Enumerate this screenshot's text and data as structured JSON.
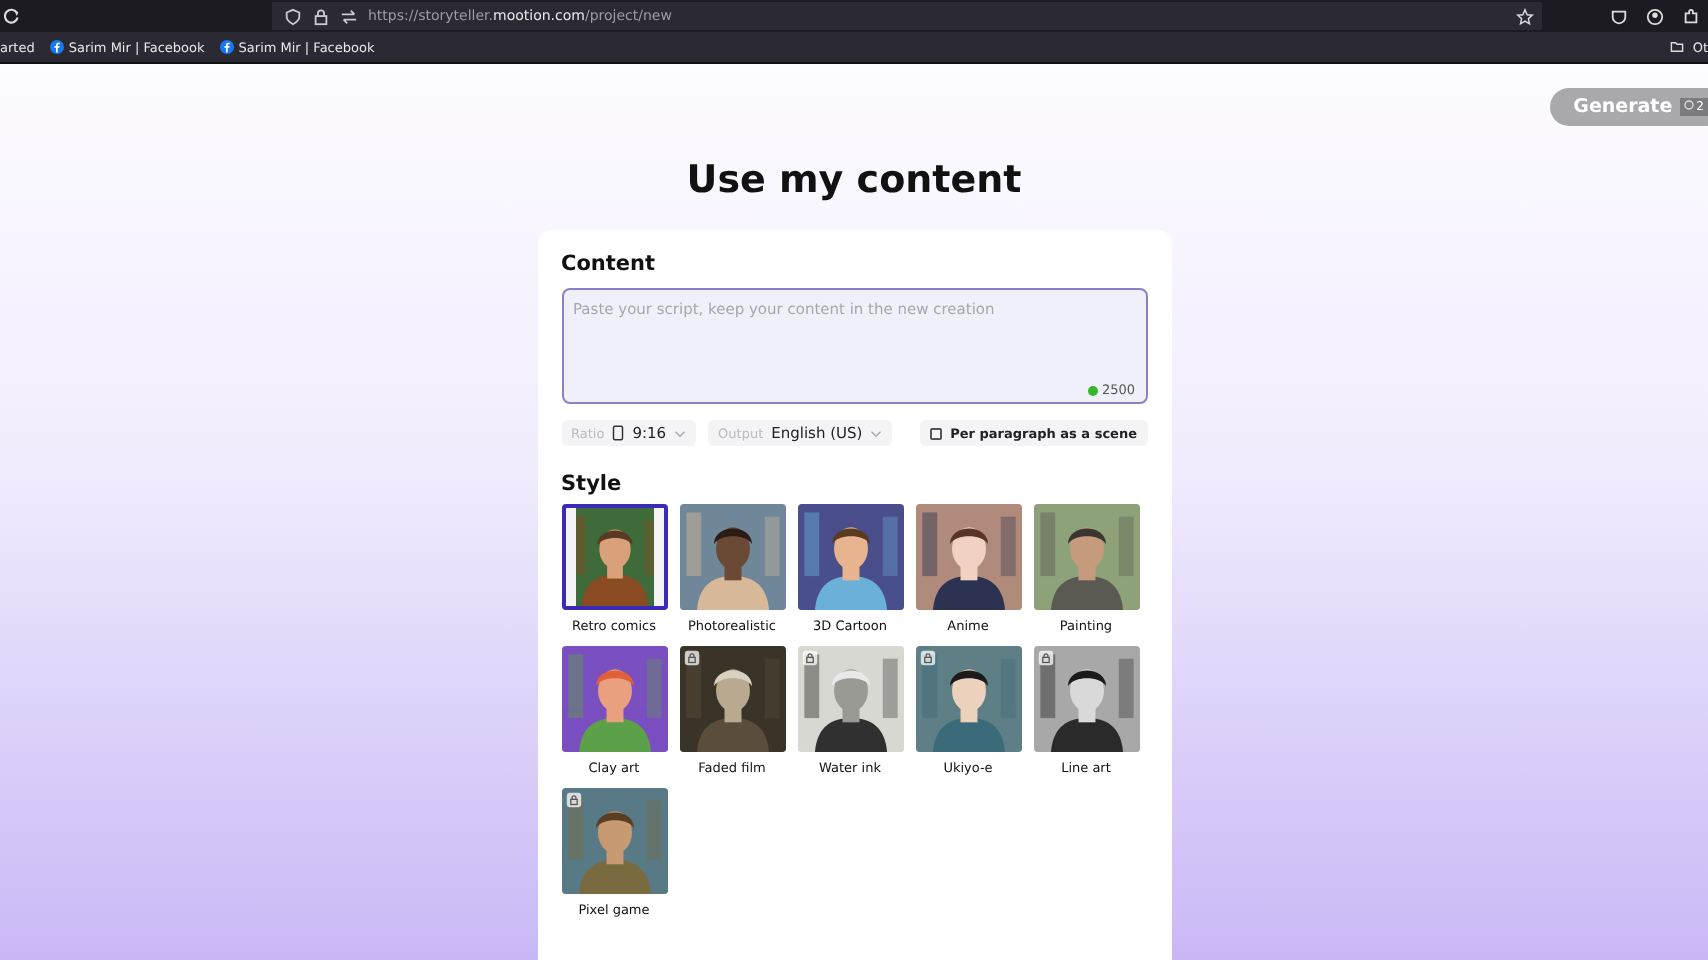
{
  "browser": {
    "url_prefix": "https://storyteller.",
    "url_domain": "mootion.com",
    "url_path": "/project/new",
    "bookmarks": [
      {
        "label": "arted",
        "kind": "plain"
      },
      {
        "label": "Sarim Mir | Facebook",
        "kind": "facebook"
      },
      {
        "label": "Sarim Mir | Facebook",
        "kind": "facebook"
      }
    ],
    "other_bookmarks": "Ot"
  },
  "generate": {
    "label": "Generate",
    "credits": "2"
  },
  "title": "Use my content",
  "content": {
    "heading": "Content",
    "placeholder": "Paste your script, keep your content in the new creation",
    "count": "2500"
  },
  "options": {
    "ratio_label": "Ratio",
    "ratio": "9:16",
    "output_label": "Output",
    "output": "English (US)",
    "per_paragraph": {
      "label": "Per paragraph as a scene",
      "checked": false
    }
  },
  "style": {
    "heading": "Style",
    "items": [
      {
        "label": "Retro comics",
        "selected": true,
        "locked": false
      },
      {
        "label": "Photorealistic",
        "selected": false,
        "locked": false
      },
      {
        "label": "3D Cartoon",
        "selected": false,
        "locked": false
      },
      {
        "label": "Anime",
        "selected": false,
        "locked": false
      },
      {
        "label": "Painting",
        "selected": false,
        "locked": false
      },
      {
        "label": "Clay art",
        "selected": false,
        "locked": false
      },
      {
        "label": "Faded film",
        "selected": false,
        "locked": true
      },
      {
        "label": "Water ink",
        "selected": false,
        "locked": true
      },
      {
        "label": "Ukiyo-e",
        "selected": false,
        "locked": true
      },
      {
        "label": "Line art",
        "selected": false,
        "locked": true
      },
      {
        "label": "Pixel game",
        "selected": false,
        "locked": true
      }
    ]
  }
}
